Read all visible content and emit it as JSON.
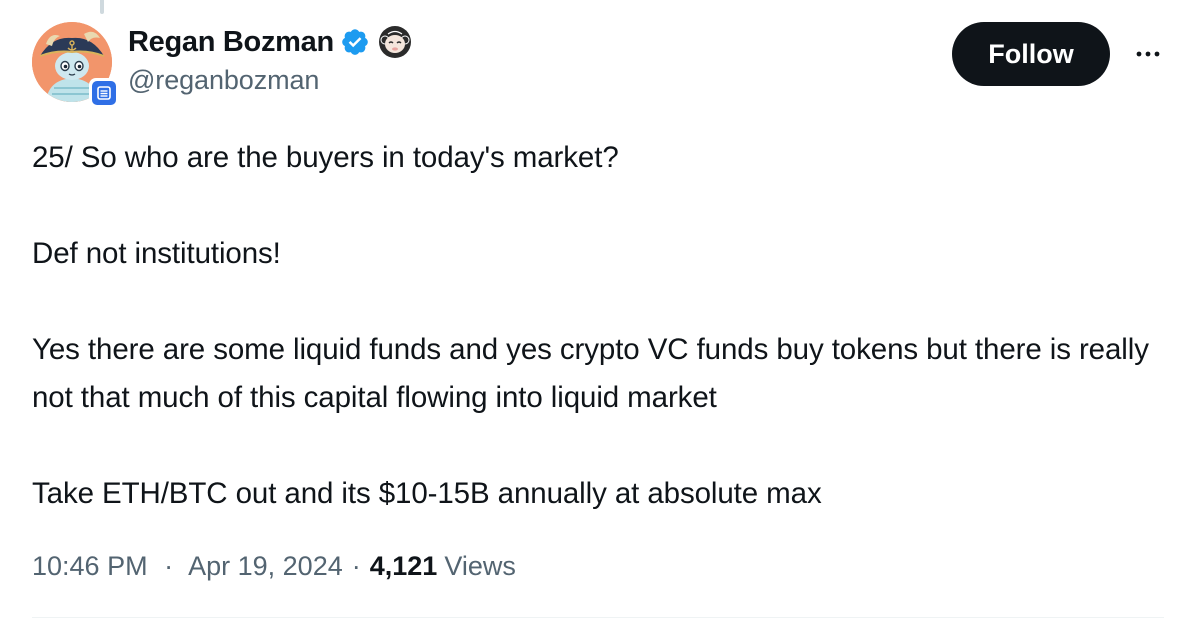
{
  "author": {
    "display_name": "Regan Bozman",
    "handle": "@reganbozman",
    "avatar_icon": "pirate-character-avatar",
    "verified_icon": "verified-badge-icon",
    "verified_color": "#1d9bf0",
    "affiliate_icon": "affiliate-org-icon",
    "affiliate_color": "#2f6fe6",
    "emoji_icon": "monkey-face-icon"
  },
  "actions": {
    "follow_label": "Follow",
    "more_icon": "more-options-icon"
  },
  "tweet": {
    "paragraphs": [
      "25/ So who are the buyers in today's market?",
      "Def not institutions!",
      "Yes there are some liquid funds and yes crypto VC funds buy tokens but there is really not that much of this capital flowing into liquid market",
      "Take ETH/BTC out and its $10-15B annually at absolute max"
    ]
  },
  "meta": {
    "time": "10:46 PM",
    "separator": "·",
    "date": "Apr 19, 2024",
    "views_count": "4,121",
    "views_label": "Views"
  },
  "colors": {
    "text_primary": "#0f1419",
    "text_secondary": "#536471",
    "follow_bg": "#0f1419"
  }
}
